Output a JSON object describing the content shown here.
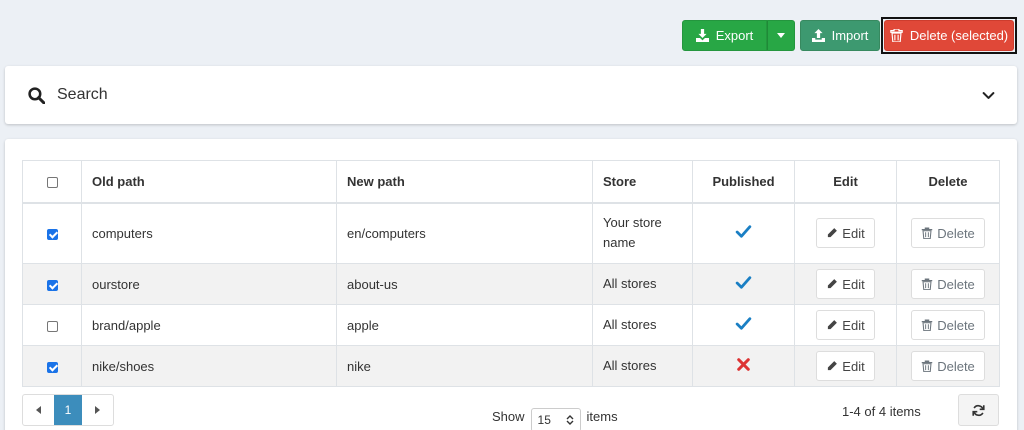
{
  "toolbar": {
    "export_label": "Export",
    "import_label": "Import",
    "delete_selected_label": "Delete (selected)"
  },
  "search": {
    "title": "Search"
  },
  "table": {
    "headers": {
      "old_path": "Old path",
      "new_path": "New path",
      "store": "Store",
      "published": "Published",
      "edit": "Edit",
      "delete": "Delete"
    },
    "rows": [
      {
        "checked": true,
        "old_path": "computers",
        "new_path": "en/computers",
        "store": "Your store name",
        "published": true,
        "edit_label": "Edit",
        "delete_label": "Delete"
      },
      {
        "checked": true,
        "old_path": "ourstore",
        "new_path": "about-us",
        "store": "All stores",
        "published": true,
        "edit_label": "Edit",
        "delete_label": "Delete"
      },
      {
        "checked": false,
        "old_path": "brand/apple",
        "new_path": "apple",
        "store": "All stores",
        "published": true,
        "edit_label": "Edit",
        "delete_label": "Delete"
      },
      {
        "checked": true,
        "old_path": "nike/shoes",
        "new_path": "nike",
        "store": "All stores",
        "published": false,
        "edit_label": "Edit",
        "delete_label": "Delete"
      }
    ]
  },
  "pager": {
    "current_page": "1",
    "show_label": "Show",
    "page_size": "15",
    "items_label": "items",
    "summary": "1-4 of 4 items"
  },
  "colors": {
    "export_green": "#28a745",
    "import_green": "#3d9970",
    "delete_red": "#e04838",
    "published_check": "#1a7fc4",
    "unpublished_x": "#dd3333",
    "pager_active": "#3c8dbc"
  }
}
